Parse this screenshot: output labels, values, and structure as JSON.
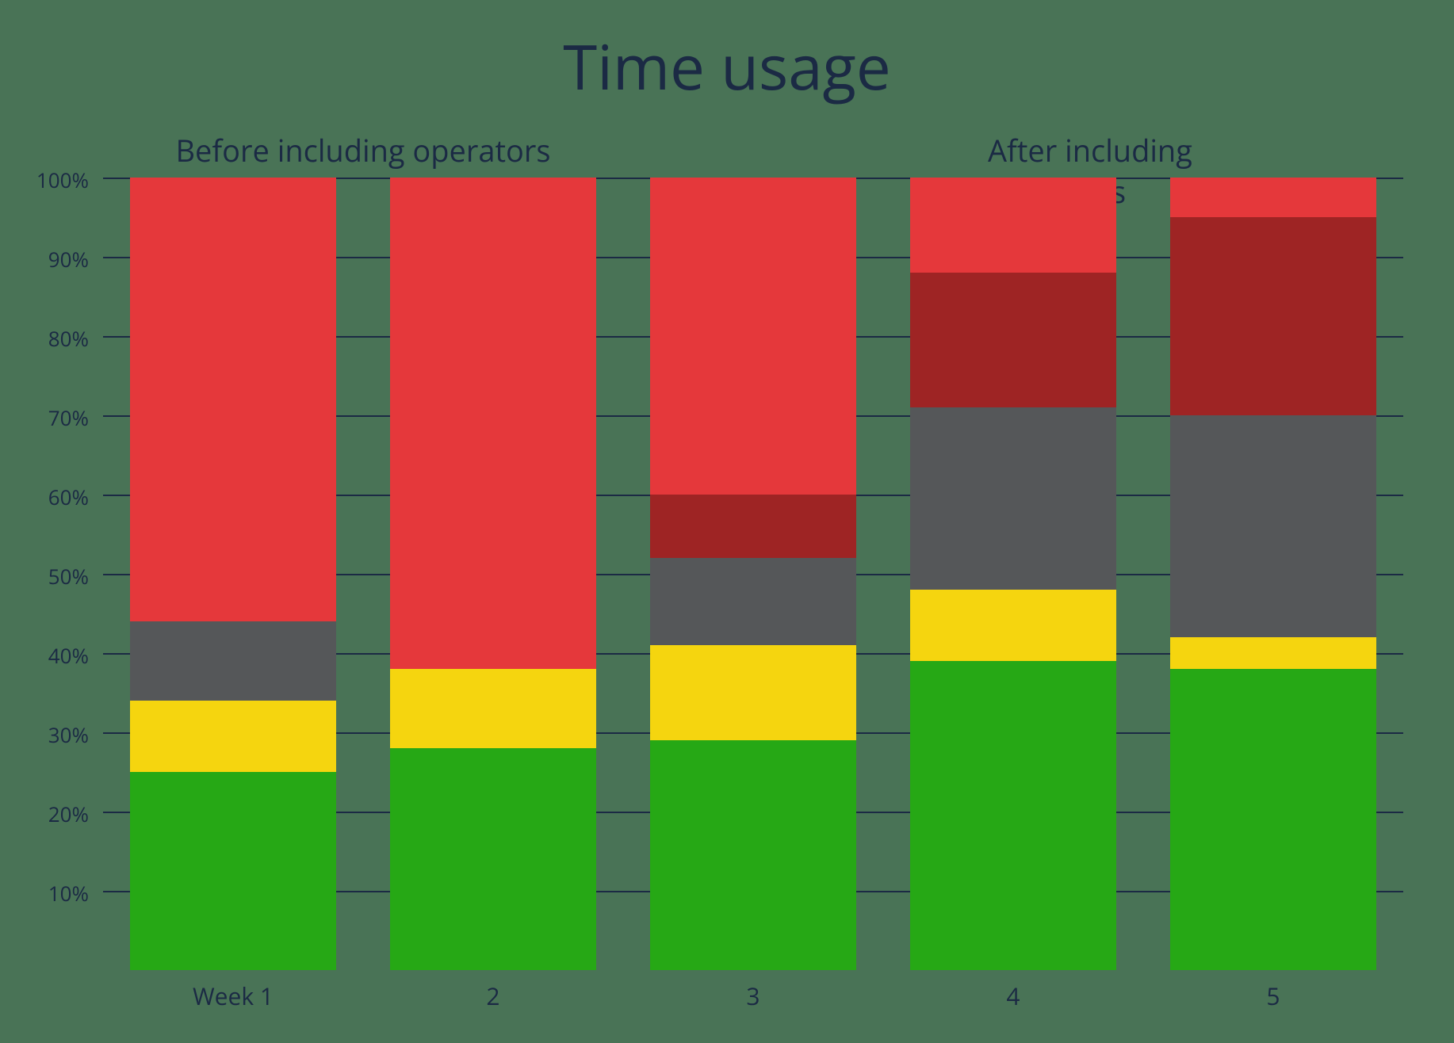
{
  "title": "Time usage",
  "subtitle_left": "Before including operators",
  "subtitle_right": "After including operators",
  "chart_data": {
    "type": "bar",
    "stacked": true,
    "categories": [
      "Week 1",
      "2",
      "3",
      "4",
      "5"
    ],
    "series": [
      {
        "name": "green",
        "color": "#26a815",
        "values": [
          25,
          28,
          29,
          39,
          38
        ]
      },
      {
        "name": "yellow",
        "color": "#f5d50f",
        "values": [
          9,
          10,
          12,
          9,
          4
        ]
      },
      {
        "name": "grey",
        "color": "#555759",
        "values": [
          10,
          0,
          11,
          23,
          28
        ]
      },
      {
        "name": "dark_red",
        "color": "#9e2424",
        "values": [
          0,
          0,
          8,
          17,
          25
        ]
      },
      {
        "name": "bright_red",
        "color": "#e5383b",
        "values": [
          56,
          62,
          40,
          12,
          5
        ]
      }
    ],
    "ylabel": "",
    "xlabel": "",
    "ylim": [
      0,
      100
    ],
    "y_ticks": [
      "10%",
      "20%",
      "30%",
      "40%",
      "50%",
      "60%",
      "70%",
      "80%",
      "90%",
      "100%"
    ],
    "subtitle_left_over_categories": [
      0,
      1
    ],
    "subtitle_right_over_categories": [
      3,
      4
    ]
  }
}
